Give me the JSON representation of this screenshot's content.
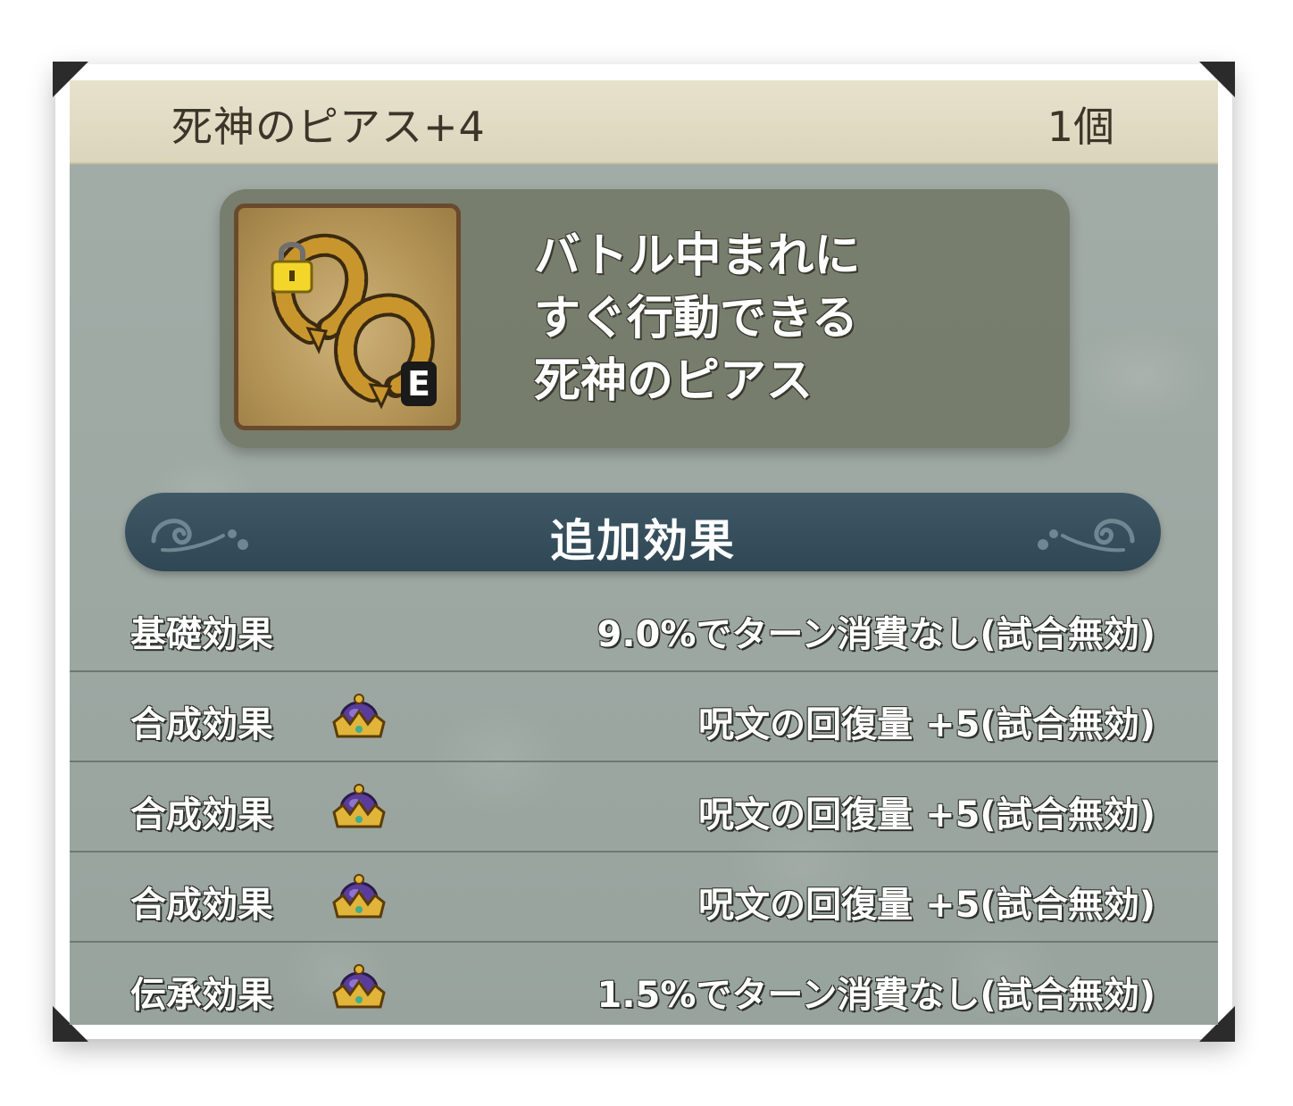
{
  "item": {
    "name": "死神のピアス+4",
    "count": "1個",
    "equip_badge": "E",
    "description": [
      "バトル中まれに",
      "すぐ行動できる",
      "死神のピアス"
    ]
  },
  "section": {
    "title": "追加効果"
  },
  "effects": [
    {
      "label": "基礎効果",
      "value": "9.0%でターン消費なし(試合無効)",
      "icon": ""
    },
    {
      "label": "合成効果",
      "value": "呪文の回復量 +5(試合無効)",
      "icon": "crown-icon"
    },
    {
      "label": "合成効果",
      "value": "呪文の回復量 +5(試合無効)",
      "icon": "crown-icon"
    },
    {
      "label": "合成効果",
      "value": "呪文の回復量 +5(試合無効)",
      "icon": "crown-icon"
    },
    {
      "label": "伝承効果",
      "value": "1.5%でターン消費なし(試合無効)",
      "icon": "crown-icon"
    }
  ],
  "colors": {
    "panel": "#9ea9a4",
    "title_bar": "#e1dcc4",
    "section_bar": "#36505d",
    "icon_bg": "#b49456",
    "crown_gold": "#e1b43a",
    "crown_purple": "#5a3c9a"
  }
}
